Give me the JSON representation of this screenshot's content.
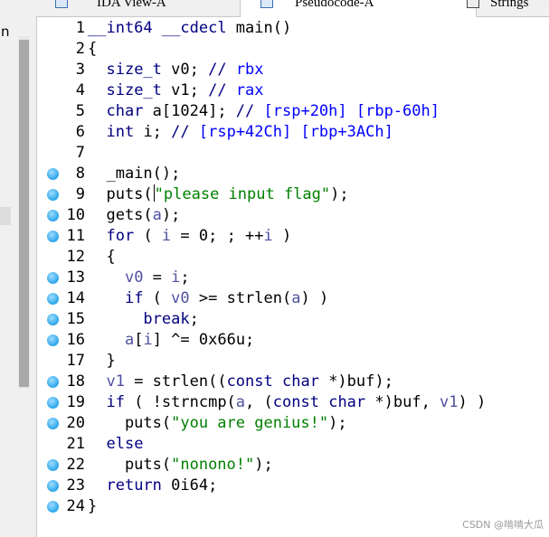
{
  "left_panel": {
    "partial_text": "n"
  },
  "tabs": [
    {
      "label": "IDA View-A",
      "active": false
    },
    {
      "label": "Pseudocode-A",
      "active": true,
      "close_glyph": "×"
    },
    {
      "label": "Strings",
      "active": false
    }
  ],
  "code": {
    "lines": [
      {
        "num": "1",
        "text": "__int64 __cdecl main()",
        "bp": false
      },
      {
        "num": "2",
        "text": "{",
        "bp": false
      },
      {
        "num": "3",
        "text": "  size_t v0; // rbx",
        "bp": false
      },
      {
        "num": "4",
        "text": "  size_t v1; // rax",
        "bp": false
      },
      {
        "num": "5",
        "text": "  char a[1024]; // [rsp+20h] [rbp-60h]",
        "bp": false
      },
      {
        "num": "6",
        "text": "  int i; // [rsp+42Ch] [rbp+3ACh]",
        "bp": false
      },
      {
        "num": "7",
        "text": "",
        "bp": false
      },
      {
        "num": "8",
        "text": "  _main();",
        "bp": true
      },
      {
        "num": "9",
        "text": "  puts(\"please input flag\");",
        "bp": true
      },
      {
        "num": "10",
        "text": "  gets(a);",
        "bp": true
      },
      {
        "num": "11",
        "text": "  for ( i = 0; ; ++i )",
        "bp": true
      },
      {
        "num": "12",
        "text": "  {",
        "bp": false
      },
      {
        "num": "13",
        "text": "    v0 = i;",
        "bp": true
      },
      {
        "num": "14",
        "text": "    if ( v0 >= strlen(a) )",
        "bp": true
      },
      {
        "num": "15",
        "text": "      break;",
        "bp": true
      },
      {
        "num": "16",
        "text": "    a[i] ^= 0x66u;",
        "bp": true
      },
      {
        "num": "17",
        "text": "  }",
        "bp": false
      },
      {
        "num": "18",
        "text": "  v1 = strlen((const char *)buf);",
        "bp": true
      },
      {
        "num": "19",
        "text": "  if ( !strncmp(a, (const char *)buf, v1) )",
        "bp": true
      },
      {
        "num": "20",
        "text": "    puts(\"you are genius!\");",
        "bp": true
      },
      {
        "num": "21",
        "text": "  else",
        "bp": false
      },
      {
        "num": "22",
        "text": "    puts(\"nonono!\");",
        "bp": true
      },
      {
        "num": "23",
        "text": "  return 0i64;",
        "bp": true
      },
      {
        "num": "24",
        "text": "}",
        "bp": true
      }
    ]
  },
  "colors": {
    "keyword": "#000080",
    "comment": "#0000ff",
    "variable": "#5050a0",
    "string": "#008000",
    "breakpoint_dot": "#2ba6ea"
  },
  "watermark": "CSDN @啃啃大瓜"
}
